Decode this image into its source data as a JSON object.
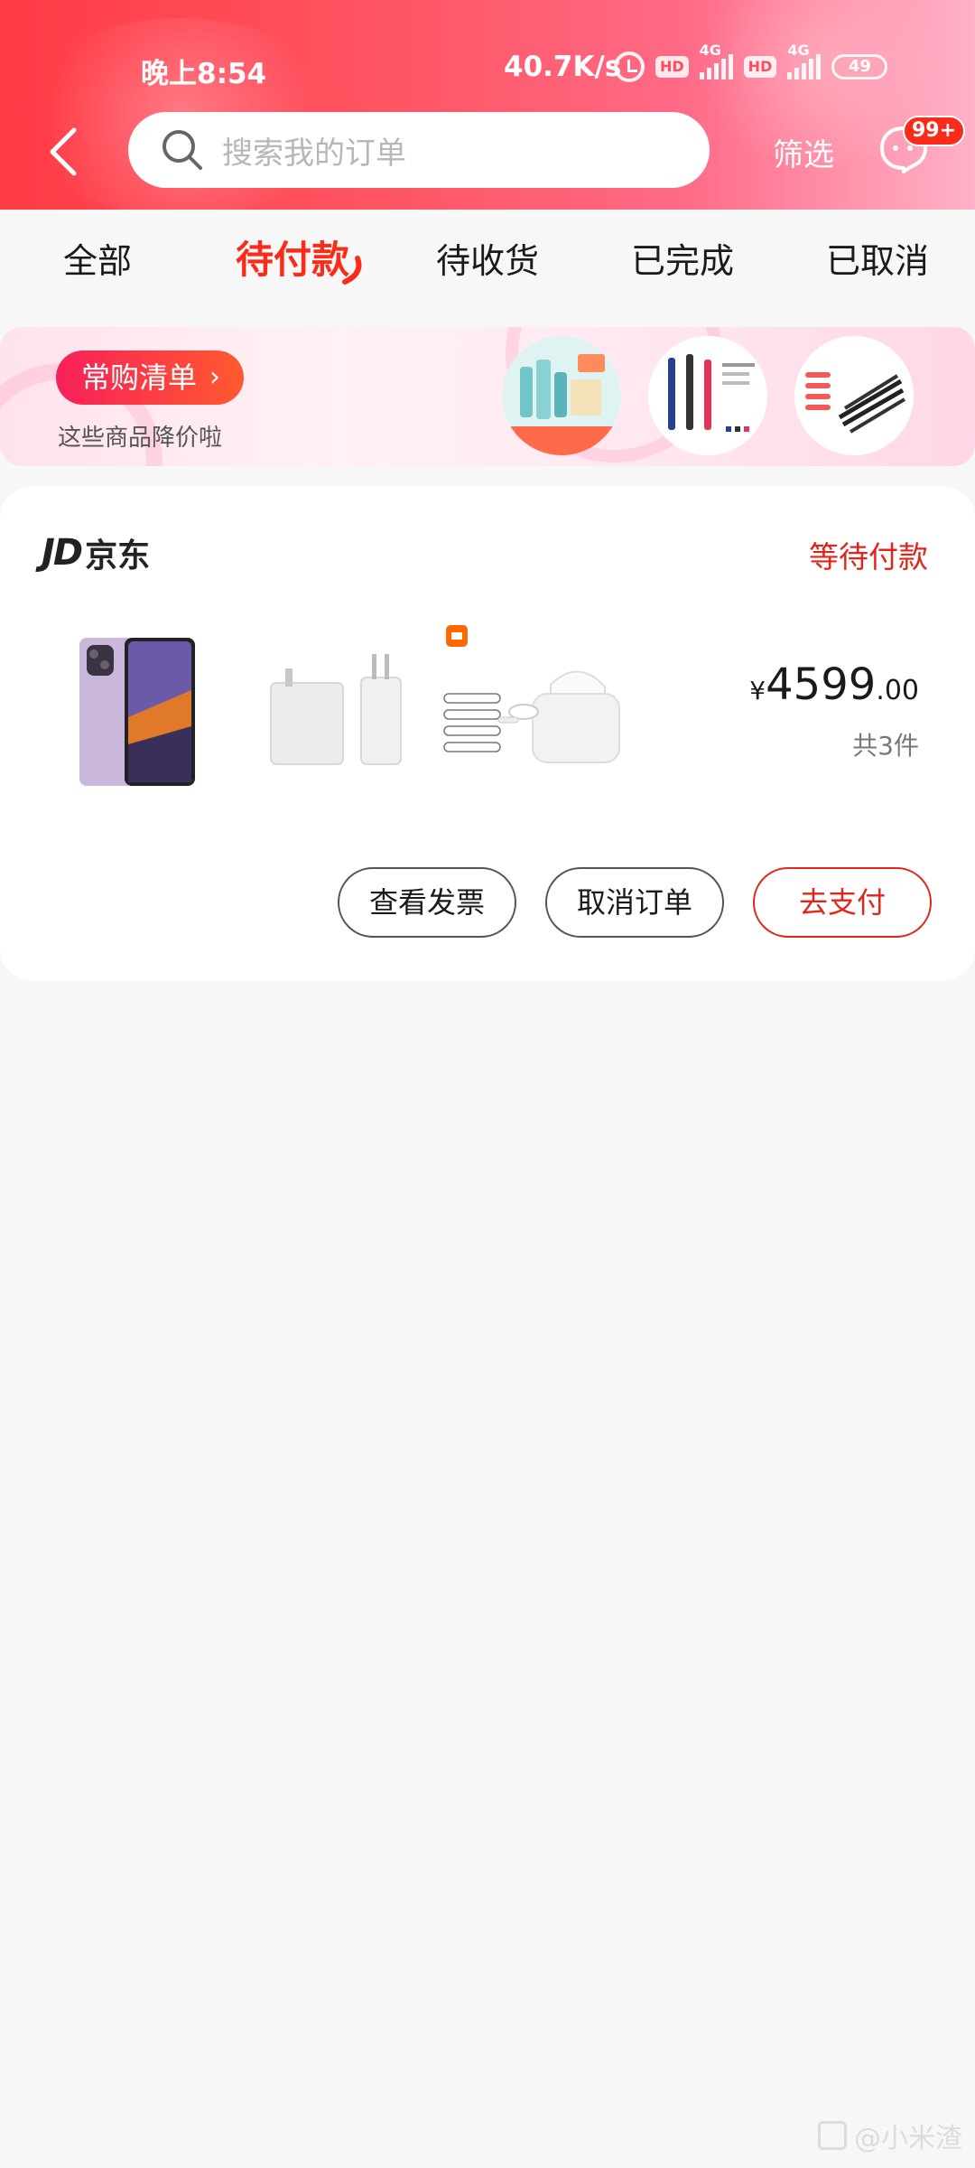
{
  "status_bar": {
    "time": "晚上8:54",
    "speed": "40.7K/s",
    "hd1": "HD",
    "net1": "4G",
    "hd2": "HD",
    "net2": "4G",
    "battery": "49"
  },
  "header": {
    "search_placeholder": "搜索我的订单",
    "filter_label": "筛选",
    "message_badge": "99+"
  },
  "tabs": [
    {
      "label": "全部"
    },
    {
      "label": "待付款",
      "active": true
    },
    {
      "label": "待收货"
    },
    {
      "label": "已完成"
    },
    {
      "label": "已取消"
    }
  ],
  "banner": {
    "pill_label": "常购清单",
    "subtitle": "这些商品降价啦"
  },
  "order": {
    "shop_mark": "JD",
    "shop_name": "京东",
    "status": "等待付款",
    "price_currency": "¥",
    "price_int": "4599",
    "price_dec": ".00",
    "item_count": "共3件",
    "buttons": {
      "invoice": "查看发票",
      "cancel": "取消订单",
      "pay": "去支付"
    }
  },
  "watermark": "@小米渣",
  "colors": {
    "accent": "#e1251b",
    "header_start": "#ff3b45",
    "header_end": "#ffb2c8"
  }
}
